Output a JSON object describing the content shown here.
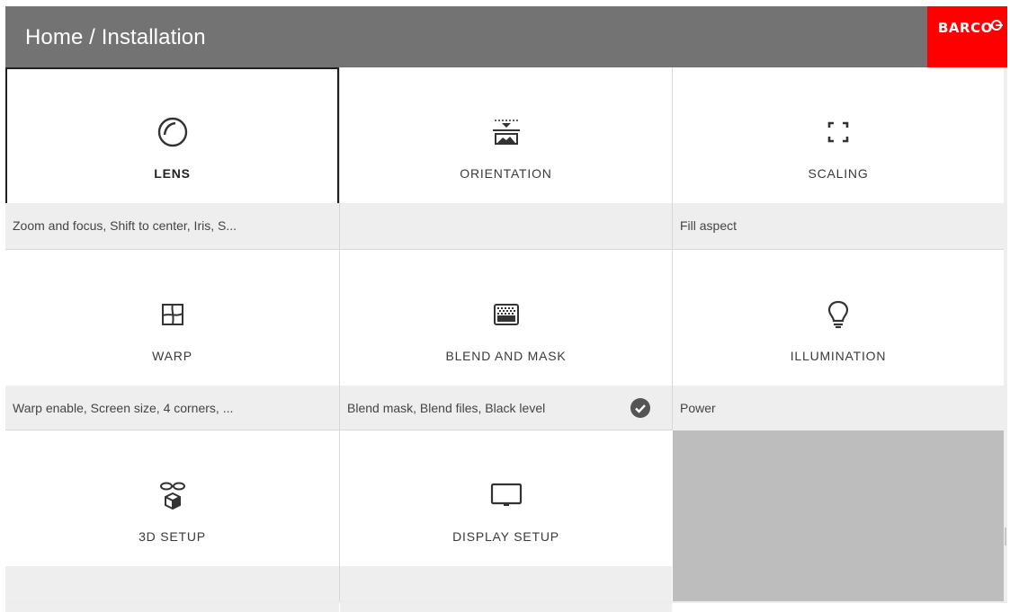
{
  "header": {
    "breadcrumb": "Home / Installation",
    "logo_text": "BARCO",
    "bg_color": "#737373",
    "logo_bg_color": "#ff0000"
  },
  "tiles": [
    {
      "label": "LENS",
      "summary": "Zoom and focus, Shift to center, Iris, S...",
      "icon": "lens-icon",
      "selected": true
    },
    {
      "label": "ORIENTATION",
      "summary": "",
      "icon": "orientation-icon"
    },
    {
      "label": "SCALING",
      "summary": "Fill aspect",
      "icon": "scaling-icon"
    },
    {
      "label": "WARP",
      "summary": "Warp enable, Screen size, 4 corners, ...",
      "icon": "warp-icon"
    },
    {
      "label": "BLEND AND MASK",
      "summary": "Blend mask, Blend files, Black level",
      "icon": "blend-mask-icon",
      "status": "check-circle-icon"
    },
    {
      "label": "ILLUMINATION",
      "summary": "Power",
      "icon": "lightbulb-icon"
    },
    {
      "label": "3D SETUP",
      "summary": "",
      "icon": "3d-glasses-icon"
    },
    {
      "label": "DISPLAY SETUP",
      "summary": "",
      "icon": "monitor-icon"
    }
  ],
  "colors": {
    "summary_bg": "#eeeeee",
    "empty_cell": "#bdbdbd",
    "accent_logo": "#ff0000"
  }
}
